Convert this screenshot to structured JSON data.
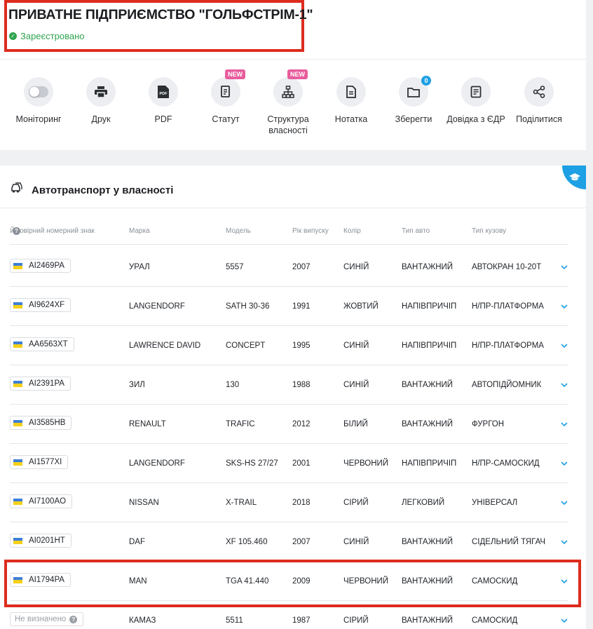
{
  "company": {
    "title": "ПРИВАТНЕ ПІДПРИЄМСТВО \"ГОЛЬФСТРІМ-1\"",
    "status": "Зареєстровано",
    "status_color": "#2ea44f"
  },
  "actions": [
    {
      "label": "Моніторинг",
      "icon": "toggle-icon"
    },
    {
      "label": "Друк",
      "icon": "printer-icon"
    },
    {
      "label": "PDF",
      "icon": "pdf-icon",
      "icon_text": "PDF"
    },
    {
      "label": "Статут",
      "icon": "document-icon",
      "badge": "NEW"
    },
    {
      "label": "Структура власності",
      "icon": "hierarchy-icon",
      "badge": "NEW"
    },
    {
      "label": "Нотатка",
      "icon": "note-icon"
    },
    {
      "label": "Зберегти",
      "icon": "folder-icon",
      "count": "0"
    },
    {
      "label": "Довідка з ЄДР",
      "icon": "certificate-icon"
    },
    {
      "label": "Поділитися",
      "icon": "share-icon"
    }
  ],
  "vehicles": {
    "title": "Автотранспорт у власності",
    "columns": {
      "plate": "Ймовірний номерний знак",
      "brand": "Марка",
      "model": "Модель",
      "year": "Рік випуску",
      "color": "Колір",
      "type": "Тип авто",
      "body": "Тип кузову"
    },
    "rows": [
      {
        "plate": "AI2469PA",
        "brand": "УРАЛ",
        "model": "5557",
        "year": "2007",
        "color": "СИНІЙ",
        "type": "ВАНТАЖНИЙ",
        "body": "АВТОКРАН 10-20Т"
      },
      {
        "plate": "AI9624XF",
        "brand": "LANGENDORF",
        "model": "SATH 30-36",
        "year": "1991",
        "color": "ЖОВТИЙ",
        "type": "НАПІВПРИЧІП",
        "body": "Н/ПР-ПЛАТФОРМА"
      },
      {
        "plate": "AA6563XT",
        "brand": "LAWRENCE DAVID",
        "model": "CONCEPT",
        "year": "1995",
        "color": "СИНІЙ",
        "type": "НАПІВПРИЧІП",
        "body": "Н/ПР-ПЛАТФОРМА"
      },
      {
        "plate": "AI2391PA",
        "brand": "ЗИЛ",
        "model": "130",
        "year": "1988",
        "color": "СИНІЙ",
        "type": "ВАНТАЖНИЙ",
        "body": "АВТОПІДЙОМНИК"
      },
      {
        "plate": "AI3585HB",
        "brand": "RENAULT",
        "model": "TRAFIC",
        "year": "2012",
        "color": "БІЛИЙ",
        "type": "ВАНТАЖНИЙ",
        "body": "ФУРГОН"
      },
      {
        "plate": "AI1577XI",
        "brand": "LANGENDORF",
        "model": "SKS-HS 27/27",
        "year": "2001",
        "color": "ЧЕРВОНИЙ",
        "type": "НАПІВПРИЧІП",
        "body": "Н/ПР-САМОСКИД"
      },
      {
        "plate": "AI7100AO",
        "brand": "NISSAN",
        "model": "X-TRAIL",
        "year": "2018",
        "color": "СІРИЙ",
        "type": "ЛЕГКОВИЙ",
        "body": "УНІВЕРСАЛ"
      },
      {
        "plate": "AI0201HT",
        "brand": "DAF",
        "model": "XF 105.460",
        "year": "2007",
        "color": "СИНІЙ",
        "type": "ВАНТАЖНИЙ",
        "body": "СІДЕЛЬНИЙ ТЯГАЧ"
      },
      {
        "plate": "AI1794PA",
        "brand": "MAN",
        "model": "TGA 41.440",
        "year": "2009",
        "color": "ЧЕРВОНИЙ",
        "type": "ВАНТАЖНИЙ",
        "body": "САМОСКИД",
        "highlighted": true
      },
      {
        "plate": "Не визначено",
        "plate_unknown": true,
        "brand": "КАМАЗ",
        "model": "5511",
        "year": "1987",
        "color": "СІРИЙ",
        "type": "ВАНТАЖНИЙ",
        "body": "САМОСКИД"
      }
    ]
  },
  "colors": {
    "accent": "#1ea0e4",
    "highlight": "#dd2c1e",
    "new_badge": "#e85d9d"
  }
}
